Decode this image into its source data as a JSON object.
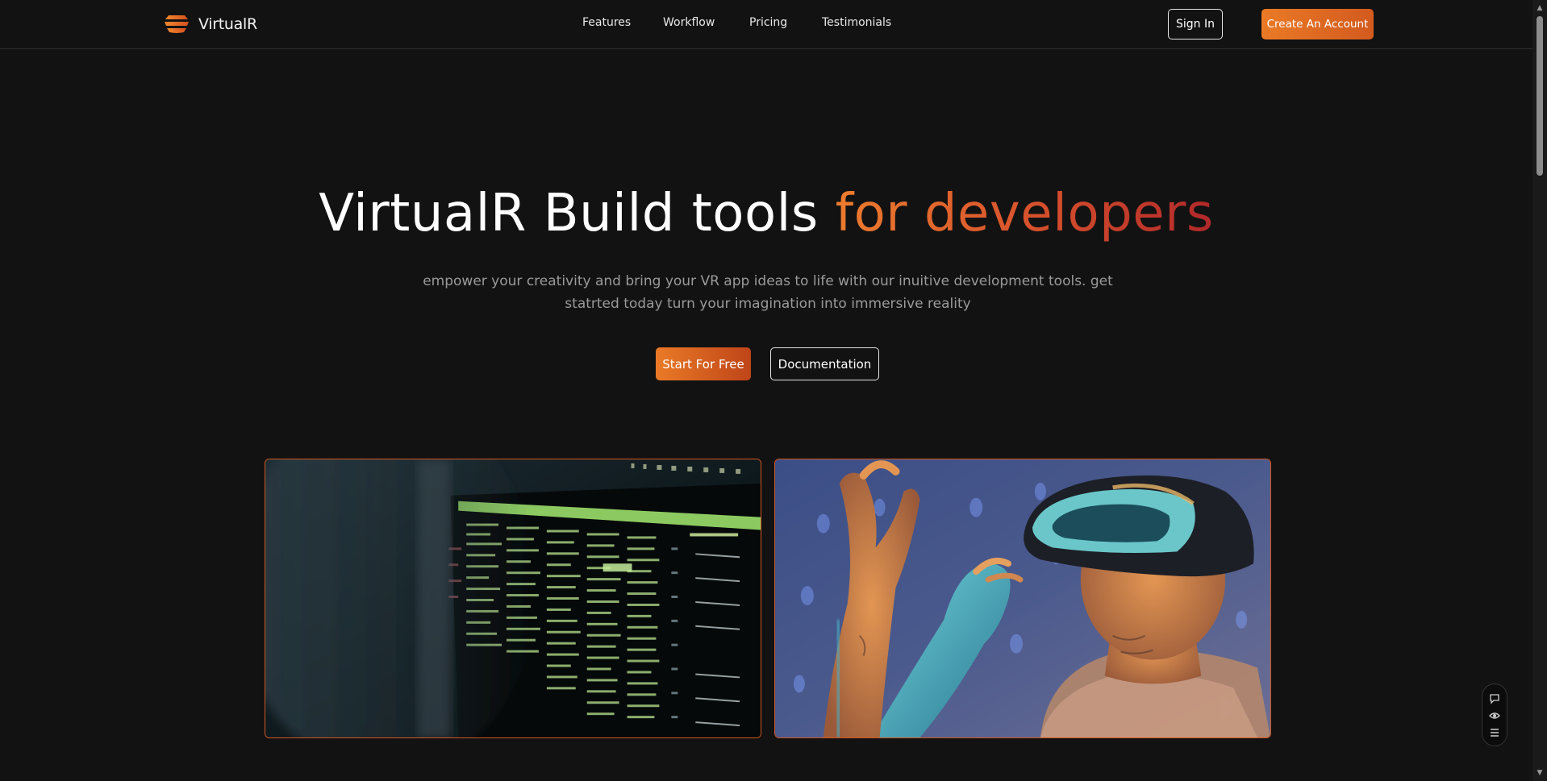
{
  "nav": {
    "brand": "VirtualR",
    "links": [
      "Features",
      "Workflow",
      "Pricing",
      "Testimonials"
    ],
    "sign_in": "Sign In",
    "create_account": "Create An Account"
  },
  "hero": {
    "title_main": "VirtualR Build tools ",
    "title_accent": "for developers",
    "subtitle": "empower your creativity and bring your VR app ideas to life with our inuitive development tools. get statrted today turn your imagination into immersive reality",
    "cta_primary": "Start For Free",
    "cta_secondary": "Documentation"
  },
  "colors": {
    "background": "#121212",
    "accent_orange": "#ea7a26",
    "accent_red": "#b1282a",
    "muted_text": "#9a9a9a"
  },
  "icons": {
    "brand_logo": "layered-stack-icon",
    "float_panel": [
      "chat-icon",
      "eye-icon",
      "list-icon"
    ],
    "scroll_up": "▲",
    "scroll_down": "▼"
  },
  "media": {
    "left_card": "code-terminal-photo",
    "right_card": "vr-headset-photo"
  }
}
